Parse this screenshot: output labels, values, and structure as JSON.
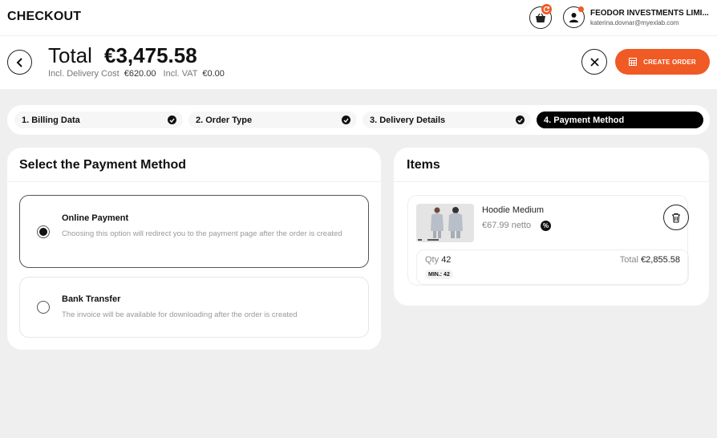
{
  "topbar": {
    "title": "CHECKOUT",
    "company": "FEODOR INVESTMENTS LIMI...",
    "email": "katerina.dovnar@myexlab.com",
    "cart_badge_icon": "refresh-icon"
  },
  "summary": {
    "total_label": "Total",
    "total_value": "€3,475.58",
    "delivery_label": "Incl. Delivery Cost",
    "delivery_value": "€620.00",
    "vat_label": "Incl. VAT",
    "vat_value": "€0.00",
    "create_order_label": "CREATE ORDER"
  },
  "steps": [
    {
      "label": "1. Billing Data",
      "completed": true
    },
    {
      "label": "2. Order Type",
      "completed": true
    },
    {
      "label": "3. Delivery Details",
      "completed": true
    },
    {
      "label": "4. Payment Method",
      "active": true
    }
  ],
  "payment": {
    "title": "Select the Payment Method",
    "options": [
      {
        "title": "Online Payment",
        "description": "Choosing this option will redirect you to the payment page after the order is created",
        "selected": true
      },
      {
        "title": "Bank Transfer",
        "description": "The invoice will be available for downloading after the order is created",
        "selected": false
      }
    ]
  },
  "items": {
    "title": "Items",
    "list": [
      {
        "name": "Hoodie Medium",
        "price": "€67.99 netto",
        "discount_icon": "%",
        "qty_label": "Qty",
        "qty_value": "42",
        "min_badge": "MIN.: 42",
        "total_label": "Total",
        "total_value": "€2,855.58"
      }
    ]
  },
  "colors": {
    "accent": "#f05a24",
    "background": "#efefef",
    "card": "#ffffff",
    "dark": "#111111"
  }
}
